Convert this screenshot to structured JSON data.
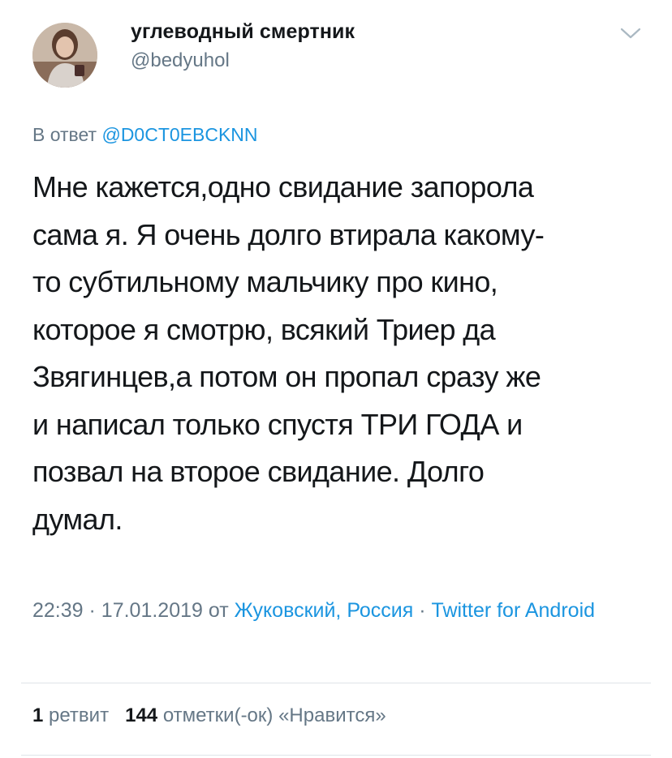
{
  "tweet": {
    "author": {
      "display_name": "углеводный смертник",
      "handle": "@bedyuhol"
    },
    "reply": {
      "prefix": "В ответ",
      "mention": "@D0CT0EBCKNN"
    },
    "text": "Мне кажется,одно свидание запорола\nсама я. Я очень долго втирала какому-\nто субтильному мальчику про кино,\nкоторое я смотрю, всякий Триер да\nЗвягинцев,а потом он пропал сразу же\nи написал только спустя ТРИ ГОДА и\nпозвал на второе свидание. Долго\nдумал.",
    "meta": {
      "time": "22:39",
      "sep1": "·",
      "date": "17.01.2019",
      "from": "от",
      "location": "Жуковский, Россия",
      "sep2": "·",
      "client": "Twitter for Android"
    },
    "stats": {
      "retweets_count": "1",
      "retweets_label": "ретвит",
      "likes_count": "144",
      "likes_label": "отметки(-ок) «Нравится»"
    }
  },
  "icons": {
    "menu": "chevron-down-icon",
    "avatar": "user-photo"
  },
  "colors": {
    "link": "#1b95e0",
    "secondary": "#657786",
    "text": "#14171a",
    "divider": "#dfe4e8"
  }
}
